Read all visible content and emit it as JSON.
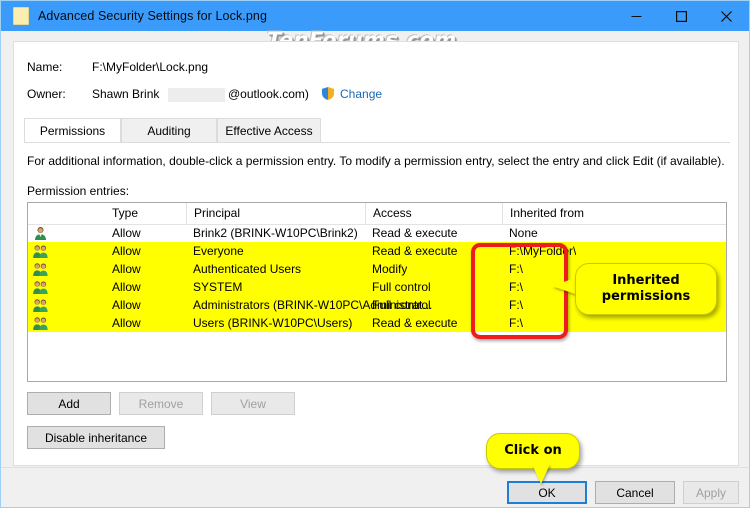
{
  "window": {
    "title": "Advanced Security Settings for Lock.png",
    "icon": "file-icon",
    "minimize_label": "—",
    "maximize_label": "□",
    "close_label": "✕"
  },
  "watermark": "TenForums.com",
  "accent_color": "#3a9bfb",
  "highlight_color": "#ffff00",
  "annotation_color": "#ee1c1c",
  "link_color": "#1769b6",
  "info": {
    "name_label": "Name:",
    "name_value": "F:\\MyFolder\\Lock.png",
    "owner_label": "Owner:",
    "owner_value": "Shawn Brink",
    "owner_suffix": "@outlook.com)",
    "change_label": "Change",
    "change_icon": "uac-shield-icon"
  },
  "tabs": [
    {
      "label": "Permissions",
      "active": true
    },
    {
      "label": "Auditing",
      "active": false
    },
    {
      "label": "Effective Access",
      "active": false
    }
  ],
  "body": {
    "info_text": "For additional information, double-click a permission entry. To modify a permission entry, select the entry and click Edit (if available).",
    "entries_label": "Permission entries:"
  },
  "table": {
    "columns": [
      "Type",
      "Principal",
      "Access",
      "Inherited from"
    ],
    "rows": [
      {
        "icon": "user-icon",
        "type": "Allow",
        "principal": "Brink2 (BRINK-W10PC\\Brink2)",
        "access": "Read & execute",
        "inherited_from": "None",
        "highlighted": false
      },
      {
        "icon": "group-icon",
        "type": "Allow",
        "principal": "Everyone",
        "access": "Read & execute",
        "inherited_from": "F:\\MyFolder\\",
        "highlighted": true
      },
      {
        "icon": "group-icon",
        "type": "Allow",
        "principal": "Authenticated Users",
        "access": "Modify",
        "inherited_from": "F:\\",
        "highlighted": true
      },
      {
        "icon": "group-icon",
        "type": "Allow",
        "principal": "SYSTEM",
        "access": "Full control",
        "inherited_from": "F:\\",
        "highlighted": true
      },
      {
        "icon": "group-icon",
        "type": "Allow",
        "principal": "Administrators (BRINK-W10PC\\Administrat...",
        "access": "Full control",
        "inherited_from": "F:\\",
        "highlighted": true
      },
      {
        "icon": "group-icon",
        "type": "Allow",
        "principal": "Users (BRINK-W10PC\\Users)",
        "access": "Read & execute",
        "inherited_from": "F:\\",
        "highlighted": true
      }
    ]
  },
  "buttons": {
    "add": "Add",
    "remove": "Remove",
    "view": "View",
    "disable_inheritance": "Disable inheritance",
    "ok": "OK",
    "cancel": "Cancel",
    "apply": "Apply"
  },
  "annotations": {
    "inherited_permissions": "Inherited permissions",
    "click_on": "Click on"
  }
}
